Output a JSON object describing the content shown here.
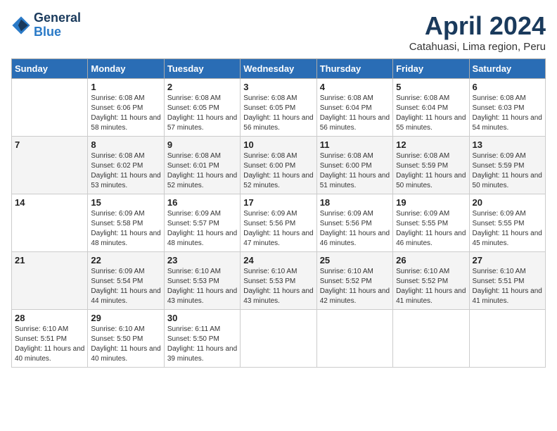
{
  "header": {
    "logo_general": "General",
    "logo_blue": "Blue",
    "title": "April 2024",
    "location": "Catahuasi, Lima region, Peru"
  },
  "weekdays": [
    "Sunday",
    "Monday",
    "Tuesday",
    "Wednesday",
    "Thursday",
    "Friday",
    "Saturday"
  ],
  "weeks": [
    [
      {
        "day": "",
        "info": ""
      },
      {
        "day": "1",
        "info": "Sunrise: 6:08 AM\nSunset: 6:06 PM\nDaylight: 11 hours\nand 58 minutes."
      },
      {
        "day": "2",
        "info": "Sunrise: 6:08 AM\nSunset: 6:05 PM\nDaylight: 11 hours\nand 57 minutes."
      },
      {
        "day": "3",
        "info": "Sunrise: 6:08 AM\nSunset: 6:05 PM\nDaylight: 11 hours\nand 56 minutes."
      },
      {
        "day": "4",
        "info": "Sunrise: 6:08 AM\nSunset: 6:04 PM\nDaylight: 11 hours\nand 56 minutes."
      },
      {
        "day": "5",
        "info": "Sunrise: 6:08 AM\nSunset: 6:04 PM\nDaylight: 11 hours\nand 55 minutes."
      },
      {
        "day": "6",
        "info": "Sunrise: 6:08 AM\nSunset: 6:03 PM\nDaylight: 11 hours\nand 54 minutes."
      }
    ],
    [
      {
        "day": "7",
        "info": ""
      },
      {
        "day": "8",
        "info": "Sunrise: 6:08 AM\nSunset: 6:02 PM\nDaylight: 11 hours\nand 53 minutes."
      },
      {
        "day": "9",
        "info": "Sunrise: 6:08 AM\nSunset: 6:01 PM\nDaylight: 11 hours\nand 52 minutes."
      },
      {
        "day": "10",
        "info": "Sunrise: 6:08 AM\nSunset: 6:00 PM\nDaylight: 11 hours\nand 52 minutes."
      },
      {
        "day": "11",
        "info": "Sunrise: 6:08 AM\nSunset: 6:00 PM\nDaylight: 11 hours\nand 51 minutes."
      },
      {
        "day": "12",
        "info": "Sunrise: 6:08 AM\nSunset: 5:59 PM\nDaylight: 11 hours\nand 50 minutes."
      },
      {
        "day": "13",
        "info": "Sunrise: 6:09 AM\nSunset: 5:59 PM\nDaylight: 11 hours\nand 50 minutes."
      }
    ],
    [
      {
        "day": "14",
        "info": ""
      },
      {
        "day": "15",
        "info": "Sunrise: 6:09 AM\nSunset: 5:58 PM\nDaylight: 11 hours\nand 48 minutes."
      },
      {
        "day": "16",
        "info": "Sunrise: 6:09 AM\nSunset: 5:57 PM\nDaylight: 11 hours\nand 48 minutes."
      },
      {
        "day": "17",
        "info": "Sunrise: 6:09 AM\nSunset: 5:56 PM\nDaylight: 11 hours\nand 47 minutes."
      },
      {
        "day": "18",
        "info": "Sunrise: 6:09 AM\nSunset: 5:56 PM\nDaylight: 11 hours\nand 46 minutes."
      },
      {
        "day": "19",
        "info": "Sunrise: 6:09 AM\nSunset: 5:55 PM\nDaylight: 11 hours\nand 46 minutes."
      },
      {
        "day": "20",
        "info": "Sunrise: 6:09 AM\nSunset: 5:55 PM\nDaylight: 11 hours\nand 45 minutes."
      }
    ],
    [
      {
        "day": "21",
        "info": ""
      },
      {
        "day": "22",
        "info": "Sunrise: 6:09 AM\nSunset: 5:54 PM\nDaylight: 11 hours\nand 44 minutes."
      },
      {
        "day": "23",
        "info": "Sunrise: 6:10 AM\nSunset: 5:53 PM\nDaylight: 11 hours\nand 43 minutes."
      },
      {
        "day": "24",
        "info": "Sunrise: 6:10 AM\nSunset: 5:53 PM\nDaylight: 11 hours\nand 43 minutes."
      },
      {
        "day": "25",
        "info": "Sunrise: 6:10 AM\nSunset: 5:52 PM\nDaylight: 11 hours\nand 42 minutes."
      },
      {
        "day": "26",
        "info": "Sunrise: 6:10 AM\nSunset: 5:52 PM\nDaylight: 11 hours\nand 41 minutes."
      },
      {
        "day": "27",
        "info": "Sunrise: 6:10 AM\nSunset: 5:51 PM\nDaylight: 11 hours\nand 41 minutes."
      }
    ],
    [
      {
        "day": "28",
        "info": "Sunrise: 6:10 AM\nSunset: 5:51 PM\nDaylight: 11 hours\nand 40 minutes."
      },
      {
        "day": "29",
        "info": "Sunrise: 6:10 AM\nSunset: 5:50 PM\nDaylight: 11 hours\nand 40 minutes."
      },
      {
        "day": "30",
        "info": "Sunrise: 6:11 AM\nSunset: 5:50 PM\nDaylight: 11 hours\nand 39 minutes."
      },
      {
        "day": "",
        "info": ""
      },
      {
        "day": "",
        "info": ""
      },
      {
        "day": "",
        "info": ""
      },
      {
        "day": "",
        "info": ""
      }
    ]
  ]
}
